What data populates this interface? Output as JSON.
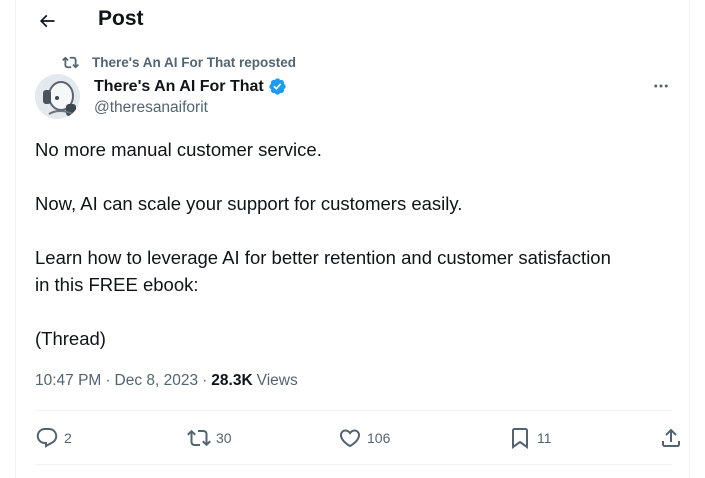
{
  "header": {
    "title": "Post"
  },
  "repost": {
    "text": "There's An AI For That reposted"
  },
  "author": {
    "name": "There's An AI For That",
    "handle": "@theresanaiforit"
  },
  "post": {
    "lines": [
      "No more manual customer service.",
      "Now, AI can scale your support for customers easily.",
      "Learn how to leverage AI for better retention and customer satisfaction",
      "in this FREE ebook:",
      "(Thread)"
    ],
    "time": "10:47 PM",
    "date": "Dec 8, 2023",
    "views_count": "28.3K",
    "views_label": "Views"
  },
  "actions": {
    "replies": "2",
    "reposts": "30",
    "likes": "106",
    "bookmarks": "11"
  },
  "colors": {
    "verified": "#1d9bf0",
    "secondary_text": "#536471",
    "primary_text": "#0f1419",
    "border": "#eff3f4"
  },
  "icons": [
    "back-arrow-icon",
    "repost-icon",
    "verified-badge-icon",
    "more-icon",
    "reply-icon",
    "retweet-icon",
    "like-icon",
    "bookmark-icon",
    "share-icon"
  ]
}
